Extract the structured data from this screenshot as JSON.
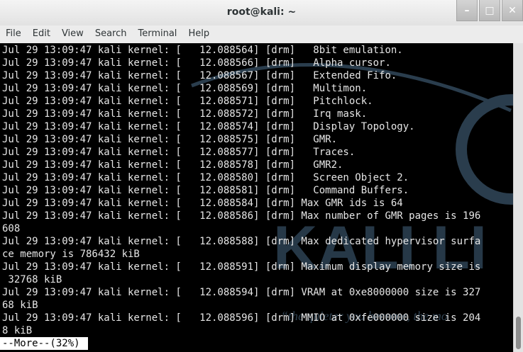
{
  "window": {
    "title": "root@kali: ~",
    "buttons": [
      "minimize",
      "maximize",
      "close"
    ]
  },
  "menu": [
    "File",
    "Edit",
    "View",
    "Search",
    "Terminal",
    "Help"
  ],
  "terminal": {
    "lines": [
      "Jul 29 13:09:47 kali kernel: [   12.088564] [drm]   8bit emulation.",
      "Jul 29 13:09:47 kali kernel: [   12.088566] [drm]   Alpha cursor.",
      "Jul 29 13:09:47 kali kernel: [   12.088567] [drm]   Extended Fifo.",
      "Jul 29 13:09:47 kali kernel: [   12.088569] [drm]   Multimon.",
      "Jul 29 13:09:47 kali kernel: [   12.088571] [drm]   Pitchlock.",
      "Jul 29 13:09:47 kali kernel: [   12.088572] [drm]   Irq mask.",
      "Jul 29 13:09:47 kali kernel: [   12.088574] [drm]   Display Topology.",
      "Jul 29 13:09:47 kali kernel: [   12.088575] [drm]   GMR.",
      "Jul 29 13:09:47 kali kernel: [   12.088577] [drm]   Traces.",
      "Jul 29 13:09:47 kali kernel: [   12.088578] [drm]   GMR2.",
      "Jul 29 13:09:47 kali kernel: [   12.088580] [drm]   Screen Object 2.",
      "Jul 29 13:09:47 kali kernel: [   12.088581] [drm]   Command Buffers.",
      "Jul 29 13:09:47 kali kernel: [   12.088584] [drm] Max GMR ids is 64",
      "Jul 29 13:09:47 kali kernel: [   12.088586] [drm] Max number of GMR pages is 196",
      "608",
      "Jul 29 13:09:47 kali kernel: [   12.088588] [drm] Max dedicated hypervisor surfa",
      "ce memory is 786432 kiB",
      "Jul 29 13:09:47 kali kernel: [   12.088591] [drm] Maximum display memory size is",
      " 32768 kiB",
      "Jul 29 13:09:47 kali kernel: [   12.088594] [drm] VRAM at 0xe8000000 size is 327",
      "68 kiB",
      "Jul 29 13:09:47 kali kernel: [   12.088596] [drm] MMIO at 0xfe000000 size is 204",
      "8 kiB"
    ],
    "status": "--More--(32%)",
    "watermark": {
      "logo": "KALI LI",
      "tagline": "“the quieter you become, the mo"
    }
  },
  "scrollbar": {
    "position_percent": 32
  }
}
